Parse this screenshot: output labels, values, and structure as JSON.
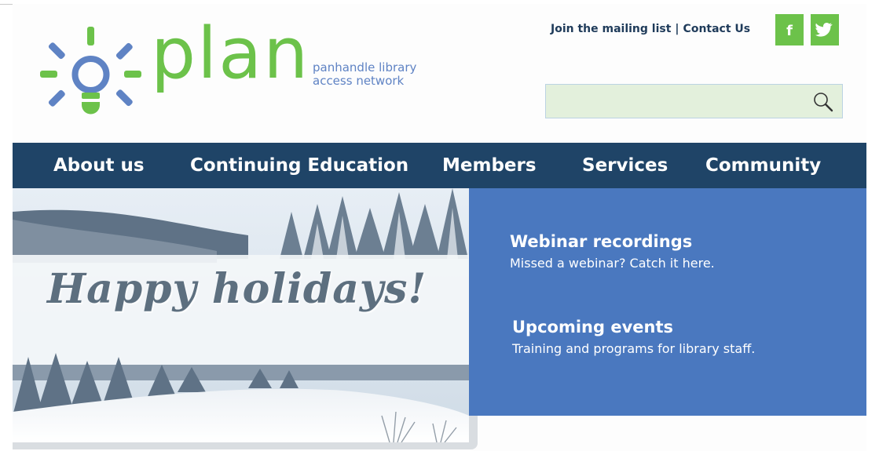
{
  "header": {
    "logo": {
      "wordmark": "plan",
      "tagline_line1": "panhandle library",
      "tagline_line2": "access network",
      "icon": "lightbulb-icon"
    },
    "links": [
      {
        "label": "Join the mailing list"
      },
      {
        "label": "Contact Us"
      }
    ],
    "link_separator": "|",
    "social": [
      {
        "name": "facebook-icon",
        "glyph": "f"
      },
      {
        "name": "twitter-icon"
      }
    ],
    "search": {
      "placeholder": "",
      "value": "",
      "icon": "search-icon"
    }
  },
  "nav": {
    "items": [
      {
        "label": "About us"
      },
      {
        "label": "Continuing Education"
      },
      {
        "label": "Members"
      },
      {
        "label": "Services"
      },
      {
        "label": "Community"
      }
    ]
  },
  "hero": {
    "title": "Happy holidays!"
  },
  "promo": {
    "items": [
      {
        "title": "Webinar recordings",
        "description": "Missed a webinar? Catch it here."
      },
      {
        "title": "Upcoming events",
        "description": "Training and programs for library staff."
      }
    ]
  },
  "colors": {
    "brand_green": "#6cc24a",
    "brand_blue": "#5f83c4",
    "nav_bg": "#1f4467",
    "promo_bg": "#4a78bf",
    "search_bg": "#e3f0dc"
  }
}
